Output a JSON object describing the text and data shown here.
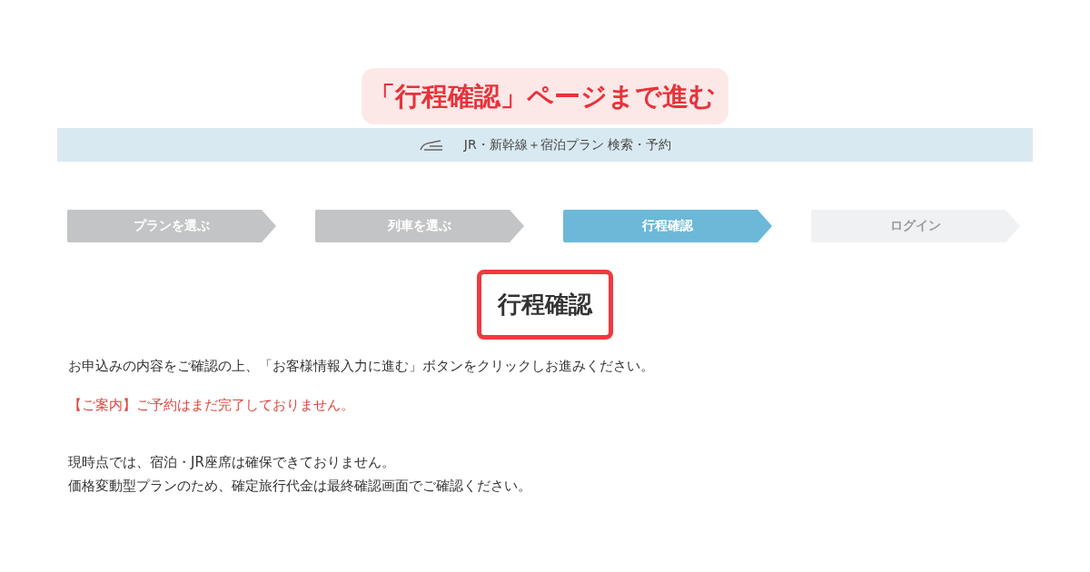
{
  "callout": {
    "text": "「行程確認」ページまで進む"
  },
  "header_bar": {
    "title": "JR・新幹線＋宿泊プラン 検索・予約"
  },
  "steps": [
    {
      "label": "プランを選ぶ",
      "kind": "done"
    },
    {
      "label": "列車を選ぶ",
      "kind": "done"
    },
    {
      "label": "行程確認",
      "kind": "current"
    },
    {
      "label": "ログイン",
      "kind": "upcoming"
    }
  ],
  "page_heading": {
    "text": "行程確認",
    "highlighted": true
  },
  "instruction": "お申込みの内容をご確認の上、「お客様情報入力に進む」ボタンをクリックしお進みください。",
  "notice": "【ご案内】ご予約はまだ完了しておりません。",
  "notes": [
    "現時点では、宿泊・JR座席は確保できておりません。",
    "価格変動型プランのため、確定旅行代金は最終確認画面でご確認ください。"
  ]
}
